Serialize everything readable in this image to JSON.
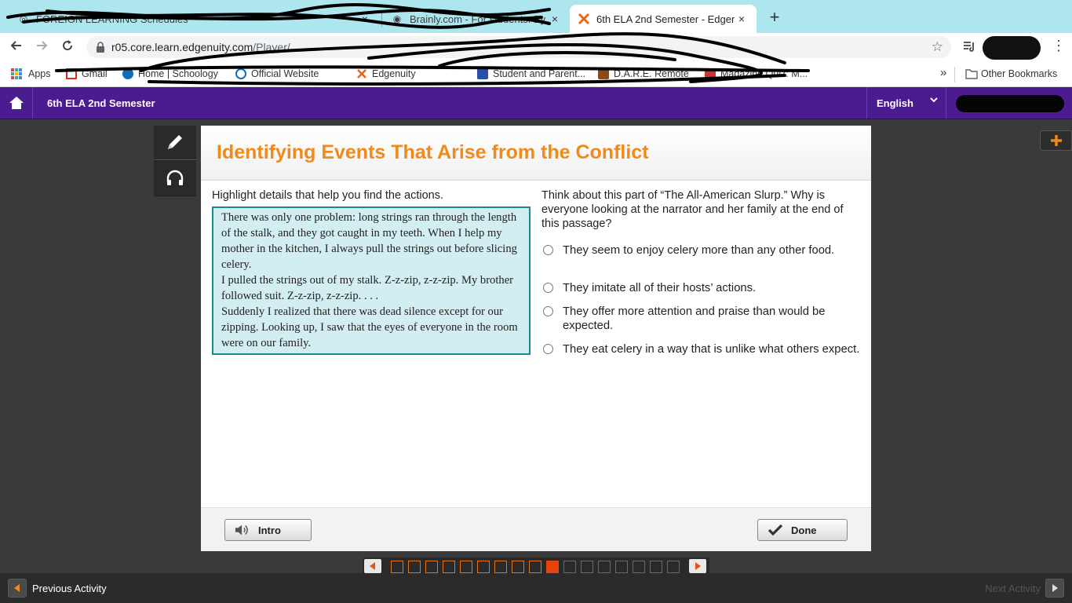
{
  "browser": {
    "tabs": [
      {
        "title": "FOREIGN LEARNING Schedules",
        "close": "×"
      },
      {
        "title": "Brainly.com - For students. By",
        "close": "×"
      },
      {
        "title": "6th ELA 2nd Semester - Edgen",
        "close": "×"
      }
    ],
    "new_tab": "+",
    "url_host": "r05.core.learn.edgenuity.com",
    "url_path": "/Player/",
    "bookmarks": [
      {
        "label": "Apps"
      },
      {
        "label": "Gmail"
      },
      {
        "label": "Home | Schoology"
      },
      {
        "label": "Official Website"
      },
      {
        "label": "Edgenuity"
      },
      {
        "label": "Student and Parent..."
      },
      {
        "label": "D.A.R.E. Remote"
      },
      {
        "label": "Magazine Quiz: M..."
      }
    ],
    "overflow": "»",
    "other_bookmarks": "Other Bookmarks"
  },
  "app": {
    "course_title": "6th ELA 2nd Semester",
    "language": "English"
  },
  "activity": {
    "title": "Identifying Events That Arise from the Conflict",
    "instruction": "Highlight details that help you find the actions.",
    "passage": [
      "There was only one problem: long strings ran through the length of the stalk, and they got caught in my teeth. When I help my mother in the kitchen, I always pull the strings out before slicing celery.",
      "I pulled the strings out of my stalk. Z-z-zip, z-z-zip. My brother followed suit. Z-z-zip, z-z-zip. . . .",
      "Suddenly I realized that there was dead silence except for our zipping. Looking up, I saw that the eyes of everyone in the room were on our family."
    ],
    "question": "Think about this part of “The All-American Slurp.” Why is everyone looking at the narrator and her family at the end of this passage?",
    "options": [
      "They seem to enjoy celery more than any other food.",
      "They imitate all of their hosts’ actions.",
      "They offer more attention and praise than would be expected.",
      "They eat celery in a way that is unlike what others expect."
    ],
    "intro_label": "Intro",
    "done_label": "Done"
  },
  "progress": {
    "total_steps": 17,
    "completed_steps": 9,
    "current_step": 10
  },
  "footer": {
    "previous_label": "Previous Activity",
    "next_label": "Next Activity"
  },
  "colors": {
    "header_purple": "#4b1c8f",
    "title_orange": "#f08a1a",
    "passage_bg": "#d2eef2",
    "passage_border": "#1a8a8f",
    "progress_done": "#e67418",
    "progress_current": "#e8430f"
  },
  "icons": {
    "home": "home-icon",
    "pencil": "pencil-icon",
    "headphones": "headphones-icon",
    "plus": "plus-icon",
    "speaker": "speaker-icon",
    "check": "check-icon"
  }
}
